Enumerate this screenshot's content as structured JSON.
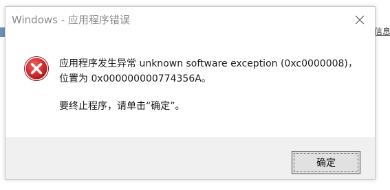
{
  "background": {
    "right_fragment_text": "信息"
  },
  "dialog": {
    "title": "Windows - 应用程序错误",
    "icon": "error-icon",
    "message_line1": "应用程序发生异常 unknown software exception (0xc0000008)，",
    "message_line2": "位置为 0x000000000774356A。",
    "message_line3": "要终止程序，请单击“确定”。",
    "ok_label": "确定",
    "close_icon": "close-icon"
  },
  "colors": {
    "error_red": "#d9282f",
    "footer_bg": "#f0f0f0",
    "title_gray": "#8a8a8a"
  }
}
